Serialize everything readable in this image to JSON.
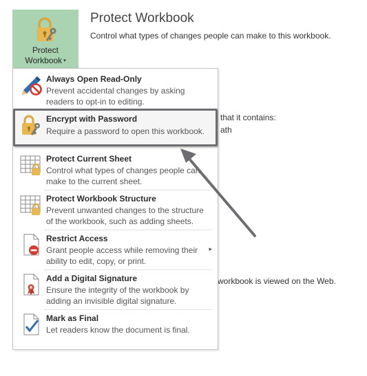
{
  "protect_button": {
    "label_line1": "Protect",
    "label_line2": "Workbook",
    "caret": "▾"
  },
  "section": {
    "title": "Protect Workbook",
    "description": "Control what types of changes people can make to this workbook."
  },
  "background_text": {
    "line1": "that it contains:",
    "line2": "ath",
    "line3": "workbook is viewed on the Web."
  },
  "menu": {
    "items": [
      {
        "title": "Always Open Read-Only",
        "mnemonic_index": 7,
        "desc1": "Prevent accidental changes by asking",
        "desc2": "readers to opt-in to editing.",
        "icon": "pencil-prohibit-icon"
      },
      {
        "title": "Encrypt with Password",
        "desc1": "Require a password to open this workbook.",
        "desc2": "",
        "icon": "lock-key-icon"
      },
      {
        "title": "Protect Current Sheet",
        "desc1": "Control what types of changes people can",
        "desc2": "make to the current sheet.",
        "icon": "sheet-lock-icon"
      },
      {
        "title": "Protect Workbook Structure",
        "desc1": "Prevent unwanted changes to the structure",
        "desc2": "of the workbook, such as adding sheets.",
        "icon": "workbook-structure-lock-icon"
      },
      {
        "title": "Restrict Access",
        "desc1": "Grant people access while removing their",
        "desc2": "ability to edit, copy, or print.",
        "icon": "document-restrict-icon",
        "has_submenu": true
      },
      {
        "title": "Add a Digital Signature",
        "desc1": "Ensure the integrity of the workbook by",
        "desc2": "adding an invisible digital signature.",
        "icon": "digital-signature-icon"
      },
      {
        "title": "Mark as Final",
        "desc1": "Let readers know the document is final.",
        "desc2": "",
        "icon": "mark-final-icon"
      }
    ],
    "submenu_arrow": "▸"
  },
  "colors": {
    "button_bg": "#a9d3b1",
    "highlight_border": "#6d6d72",
    "lock_gold": "#e2b34a"
  }
}
